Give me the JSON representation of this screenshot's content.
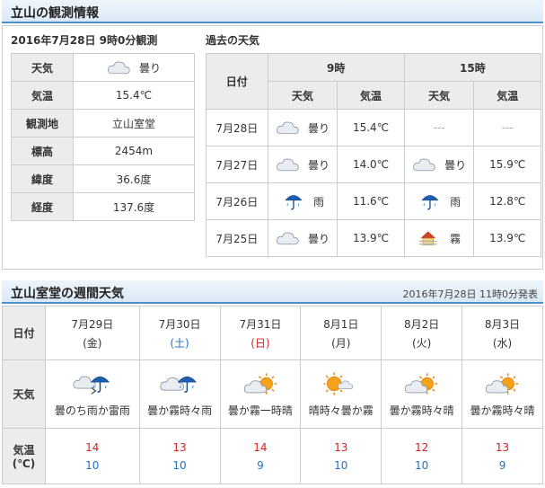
{
  "obs": {
    "title": "立山の観測情報",
    "time": "2016年7月28日 9時0分観測",
    "rows": [
      {
        "label": "天気",
        "value": "曇り",
        "icon": "cloud-icon"
      },
      {
        "label": "気温",
        "value": "15.4℃"
      },
      {
        "label": "観測地",
        "value": "立山室堂"
      },
      {
        "label": "標高",
        "value": "2454m"
      },
      {
        "label": "緯度",
        "value": "36.6度"
      },
      {
        "label": "経度",
        "value": "137.6度"
      }
    ]
  },
  "past": {
    "title": "過去の天気",
    "head_date": "日付",
    "head_9": "9時",
    "head_15": "15時",
    "head_weather": "天気",
    "head_temp": "気温",
    "rows": [
      {
        "date": "7月28日",
        "w9": "曇り",
        "i9": "cloud-icon",
        "t9": "15.4℃",
        "w15": "---",
        "i15": "",
        "t15": "---"
      },
      {
        "date": "7月27日",
        "w9": "曇り",
        "i9": "cloud-icon",
        "t9": "14.0℃",
        "w15": "曇り",
        "i15": "cloud-icon",
        "t15": "15.9℃"
      },
      {
        "date": "7月26日",
        "w9": "雨",
        "i9": "umbrella-icon",
        "t9": "11.6℃",
        "w15": "雨",
        "i15": "umbrella-icon",
        "t15": "12.8℃"
      },
      {
        "date": "7月25日",
        "w9": "曇り",
        "i9": "cloud-icon",
        "t9": "13.9℃",
        "w15": "霧",
        "i15": "fog-house-icon",
        "t15": "13.9℃"
      }
    ]
  },
  "weekly": {
    "title": "立山室堂の週間天気",
    "announced": "2016年7月28日 11時0分発表",
    "label_date": "日付",
    "label_weather": "天気",
    "label_temp_1": "気温",
    "label_temp_2": "(℃)",
    "days": [
      {
        "date": "7月29日",
        "dow": "(金)",
        "dow_color": "#333333",
        "forecast": "曇のち雨か雷雨",
        "icon": "cloud-then-rain-icon",
        "high": "14",
        "low": "10"
      },
      {
        "date": "7月30日",
        "dow": "(土)",
        "dow_color": "#2271c4",
        "forecast": "曇か霧時々雨",
        "icon": "cloud-rain-icon",
        "high": "13",
        "low": "10"
      },
      {
        "date": "7月31日",
        "dow": "(日)",
        "dow_color": "#d61f1f",
        "forecast": "曇か霧一時晴",
        "icon": "cloud-sun-icon",
        "high": "14",
        "low": "9"
      },
      {
        "date": "8月1日",
        "dow": "(月)",
        "dow_color": "#333333",
        "forecast": "晴時々曇か霧",
        "icon": "sun-cloud-icon",
        "high": "13",
        "low": "10"
      },
      {
        "date": "8月2日",
        "dow": "(火)",
        "dow_color": "#333333",
        "forecast": "曇か霧時々晴",
        "icon": "cloud-sun-icon",
        "high": "12",
        "low": "10"
      },
      {
        "date": "8月3日",
        "dow": "(水)",
        "dow_color": "#333333",
        "forecast": "曇か霧時々晴",
        "icon": "cloud-sun-icon",
        "high": "13",
        "low": "9"
      }
    ]
  }
}
